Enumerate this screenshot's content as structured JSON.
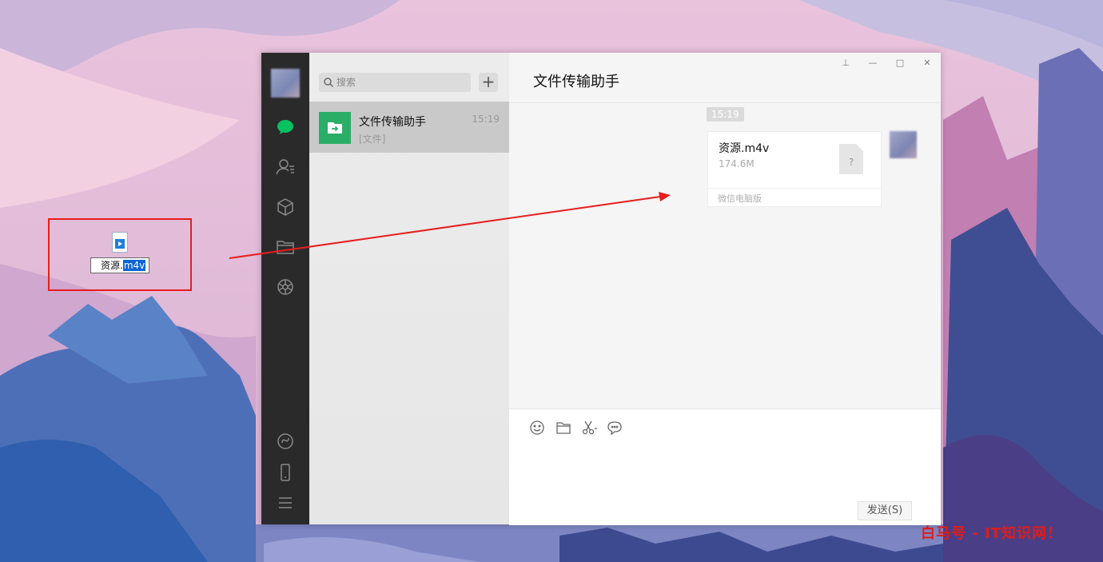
{
  "desktop": {
    "file_name_plain": "资源.",
    "file_name_selected": "m4v"
  },
  "wechat": {
    "search_placeholder": "搜索",
    "add_label": "+",
    "chat_list": [
      {
        "name": "文件传输助手",
        "time": "15:19",
        "preview": "[文件]"
      }
    ],
    "chat_title": "文件传输助手",
    "message_time": "15:19",
    "file_message": {
      "file_name": "资源.m4v",
      "file_size": "174.6M",
      "doc_glyph": "?",
      "source": "微信电脑版"
    },
    "send_label": "发送(S)",
    "window_controls": {
      "pin": "⊥",
      "minimize": "—",
      "maximize": "□",
      "close": "✕"
    }
  },
  "watermark": "白马号 - IT知识网！",
  "colors": {
    "accent_green": "#2aae67",
    "highlight_red": "#e81d1d",
    "nav_bg": "#2a2a2b"
  }
}
